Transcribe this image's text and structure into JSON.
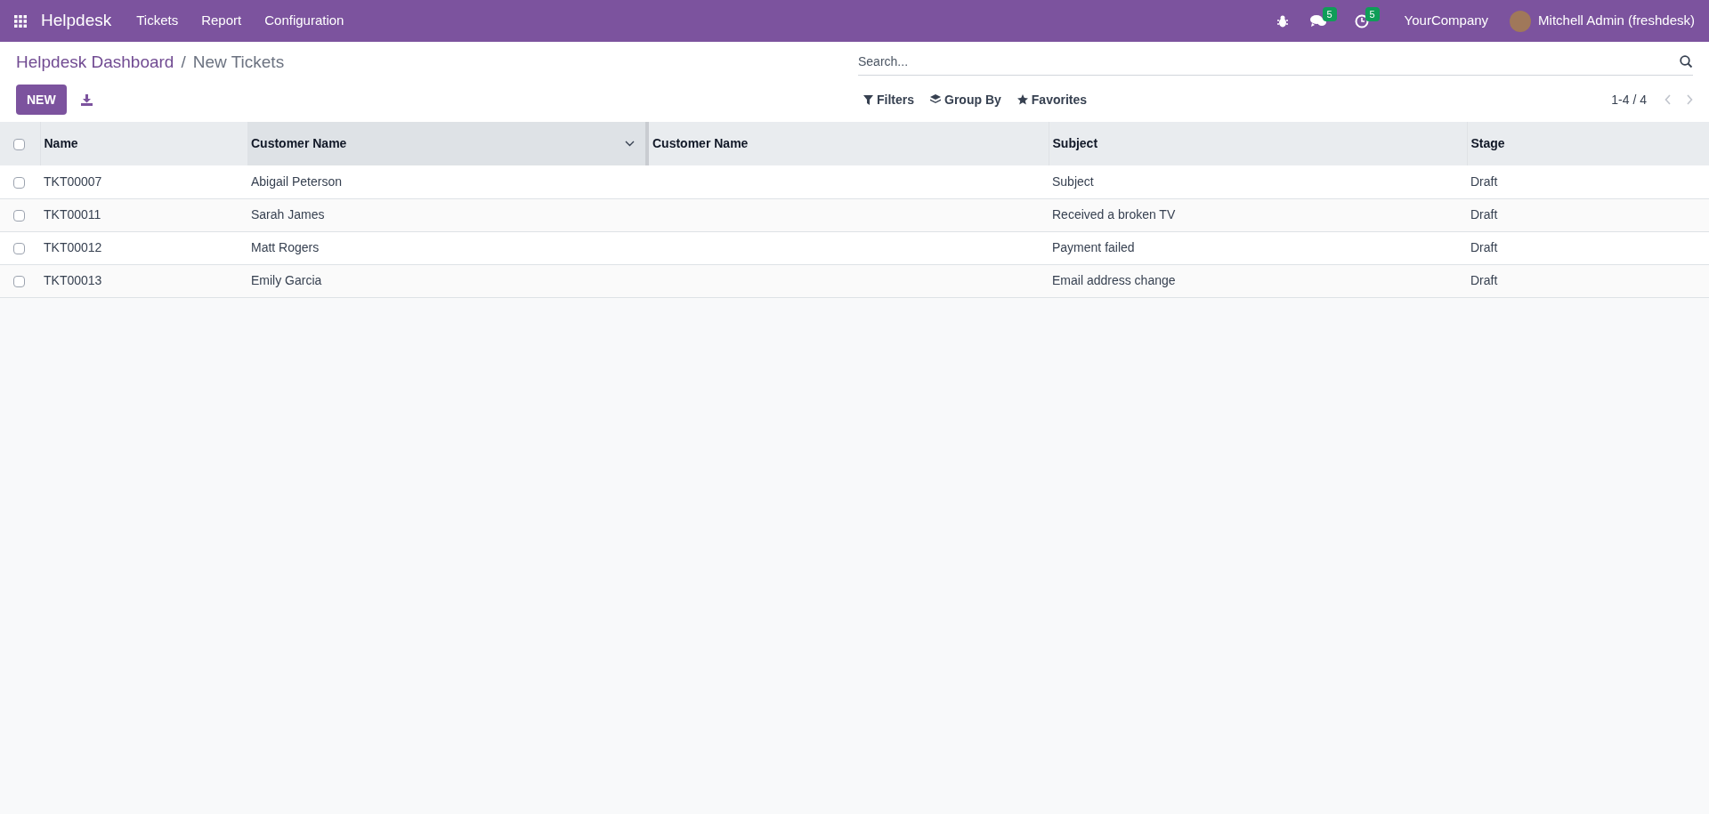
{
  "navbar": {
    "app_name": "Helpdesk",
    "menu": [
      "Tickets",
      "Report",
      "Configuration"
    ],
    "messages_badge": "5",
    "activities_badge": "5",
    "company": "YourCompany",
    "user": "Mitchell Admin (freshdesk)"
  },
  "breadcrumb": {
    "parent": "Helpdesk Dashboard",
    "separator": "/",
    "current": "New Tickets"
  },
  "search": {
    "placeholder": "Search..."
  },
  "toolbar": {
    "new_button": "NEW",
    "filters": "Filters",
    "group_by": "Group By",
    "favorites": "Favorites",
    "pager": "1-4 / 4"
  },
  "table": {
    "select_all_checked": false,
    "columns": [
      {
        "label": "Name",
        "active": false
      },
      {
        "label": "Customer Name",
        "active": true
      },
      {
        "label": "Customer Name",
        "active": false
      },
      {
        "label": "Subject",
        "active": false
      },
      {
        "label": "Stage",
        "active": false
      }
    ],
    "rows": [
      {
        "checked": false,
        "cells": [
          "TKT00007",
          "Abigail Peterson",
          "",
          "Subject",
          "Draft"
        ]
      },
      {
        "checked": false,
        "cells": [
          "TKT00011",
          "Sarah James",
          "",
          "Received a broken TV",
          "Draft"
        ]
      },
      {
        "checked": false,
        "cells": [
          "TKT00012",
          "Matt Rogers",
          "",
          "Payment failed",
          "Draft"
        ]
      },
      {
        "checked": false,
        "cells": [
          "TKT00013",
          "Emily Garcia",
          "",
          "Email address change",
          "Draft"
        ]
      }
    ]
  }
}
